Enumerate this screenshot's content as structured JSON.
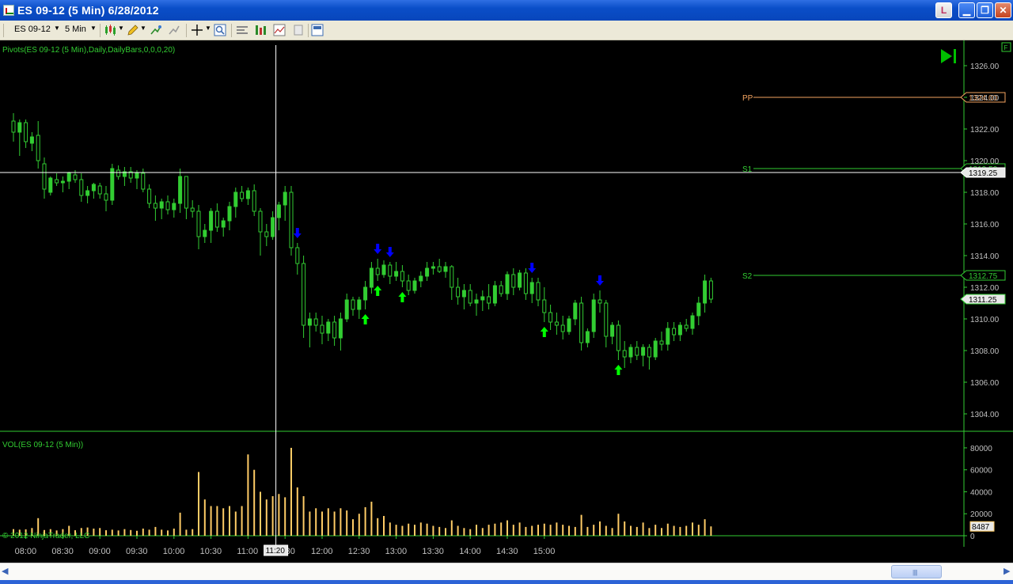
{
  "window": {
    "title": "ES 09-12 (5 Min)  6/28/2012",
    "link_label": "L"
  },
  "toolbar": {
    "instrument": "ES 09-12",
    "interval": "5 Min"
  },
  "icons": {
    "chart_style": "candlestick-icon",
    "draw": "pencil-icon",
    "crosshair": "crosshair-icon",
    "zoom": "zoom-icon",
    "properties": "properties-icon",
    "indicators": "indicators-icon",
    "strategies": "strategies-icon",
    "data_box": "data-box-icon",
    "templates": "templates-icon",
    "go_to_end": "play-end-icon"
  },
  "price_panel": {
    "indicator_label": "Pivots(ES 09-12 (5 Min),Daily,DailyBars,0,0,0,20)",
    "y_ticks": [
      "1326.00",
      "1324.00",
      "1322.00",
      "1320.00",
      "1318.00",
      "1316.00",
      "1314.00",
      "1312.00",
      "1310.00",
      "1308.00",
      "1306.00",
      "1304.00"
    ],
    "pivots": [
      {
        "name": "PP",
        "value": 1324.0,
        "label": "1324.00",
        "color": "#f4a460"
      },
      {
        "name": "S1",
        "value": 1319.5,
        "label": "1319.50",
        "color": "#32cd32"
      },
      {
        "name": "S2",
        "value": 1312.75,
        "label": "1312.75",
        "color": "#32cd32"
      }
    ],
    "crosshair_price": "1319.25",
    "last_price": "1311.25"
  },
  "volume_panel": {
    "indicator_label": "VOL(ES 09-12 (5 Min))",
    "y_ticks": [
      "80000",
      "60000",
      "40000",
      "20000",
      "0"
    ],
    "last_volume": "8487"
  },
  "time_axis": {
    "labels": [
      "08:00",
      "08:30",
      "09:00",
      "09:30",
      "10:00",
      "10:30",
      "11:00",
      "11:30",
      "12:00",
      "12:30",
      "13:00",
      "13:30",
      "14:00",
      "14:30",
      "15:00"
    ],
    "crosshair_time": "11:20"
  },
  "copyright": "© 2012 NinjaTrader, LLC",
  "corner_flag": "F",
  "colors": {
    "up_bar": "#32cd32",
    "volume_bar": "#ffcc66",
    "panel_divider": "#32cd32",
    "axis_text": "#c0c0c0",
    "buy_arrow": "#00ff00",
    "sell_arrow": "#0000ff"
  },
  "chart_data": {
    "type": "candlestick",
    "bars": [
      {
        "t": "07:50",
        "o": 1322.5,
        "h": 1323.0,
        "l": 1321.2,
        "c": 1321.8,
        "v": 6000
      },
      {
        "t": "07:55",
        "o": 1321.8,
        "h": 1322.6,
        "l": 1320.3,
        "c": 1322.4,
        "v": 5500
      },
      {
        "t": "08:00",
        "o": 1322.4,
        "h": 1322.6,
        "l": 1320.8,
        "c": 1321.2,
        "v": 5800
      },
      {
        "t": "08:05",
        "o": 1321.1,
        "h": 1321.8,
        "l": 1320.6,
        "c": 1321.5,
        "v": 7000
      },
      {
        "t": "08:10",
        "o": 1321.6,
        "h": 1322.5,
        "l": 1319.5,
        "c": 1320.0,
        "v": 16000
      },
      {
        "t": "08:15",
        "o": 1319.8,
        "h": 1320.2,
        "l": 1317.6,
        "c": 1318.2,
        "v": 5200
      },
      {
        "t": "08:20",
        "o": 1318.0,
        "h": 1319.0,
        "l": 1317.8,
        "c": 1318.9,
        "v": 6000
      },
      {
        "t": "08:25",
        "o": 1318.8,
        "h": 1319.2,
        "l": 1318.4,
        "c": 1318.6,
        "v": 4800
      },
      {
        "t": "08:30",
        "o": 1318.6,
        "h": 1319.0,
        "l": 1318.0,
        "c": 1318.7,
        "v": 6000
      },
      {
        "t": "08:35",
        "o": 1318.7,
        "h": 1319.3,
        "l": 1318.2,
        "c": 1319.2,
        "v": 9000
      },
      {
        "t": "08:40",
        "o": 1319.1,
        "h": 1319.4,
        "l": 1318.6,
        "c": 1318.8,
        "v": 5000
      },
      {
        "t": "08:45",
        "o": 1318.8,
        "h": 1319.2,
        "l": 1317.4,
        "c": 1317.8,
        "v": 7000
      },
      {
        "t": "08:50",
        "o": 1317.8,
        "h": 1318.4,
        "l": 1317.3,
        "c": 1318.1,
        "v": 7500
      },
      {
        "t": "08:55",
        "o": 1318.1,
        "h": 1318.6,
        "l": 1317.6,
        "c": 1318.5,
        "v": 6500
      },
      {
        "t": "09:00",
        "o": 1318.4,
        "h": 1318.6,
        "l": 1317.6,
        "c": 1317.9,
        "v": 7000
      },
      {
        "t": "09:05",
        "o": 1317.9,
        "h": 1318.4,
        "l": 1316.8,
        "c": 1317.5,
        "v": 5000
      },
      {
        "t": "09:10",
        "o": 1317.5,
        "h": 1319.8,
        "l": 1317.2,
        "c": 1319.5,
        "v": 5500
      },
      {
        "t": "09:15",
        "o": 1319.4,
        "h": 1319.7,
        "l": 1318.8,
        "c": 1319.0,
        "v": 4800
      },
      {
        "t": "09:20",
        "o": 1319.0,
        "h": 1319.6,
        "l": 1318.4,
        "c": 1319.3,
        "v": 6000
      },
      {
        "t": "09:25",
        "o": 1319.3,
        "h": 1319.6,
        "l": 1318.6,
        "c": 1318.9,
        "v": 5200
      },
      {
        "t": "09:30",
        "o": 1318.9,
        "h": 1319.4,
        "l": 1318.2,
        "c": 1319.2,
        "v": 4500
      },
      {
        "t": "09:35",
        "o": 1319.2,
        "h": 1319.5,
        "l": 1318.0,
        "c": 1318.2,
        "v": 6500
      },
      {
        "t": "09:40",
        "o": 1318.2,
        "h": 1318.5,
        "l": 1317.0,
        "c": 1317.3,
        "v": 5500
      },
      {
        "t": "09:45",
        "o": 1317.3,
        "h": 1317.8,
        "l": 1316.2,
        "c": 1317.0,
        "v": 8000
      },
      {
        "t": "09:50",
        "o": 1317.0,
        "h": 1317.6,
        "l": 1316.3,
        "c": 1317.4,
        "v": 5500
      },
      {
        "t": "09:55",
        "o": 1317.4,
        "h": 1317.8,
        "l": 1316.6,
        "c": 1316.9,
        "v": 4800
      },
      {
        "t": "10:00",
        "o": 1316.9,
        "h": 1317.6,
        "l": 1316.4,
        "c": 1317.3,
        "v": 6500
      },
      {
        "t": "10:05",
        "o": 1317.3,
        "h": 1319.5,
        "l": 1316.7,
        "c": 1319.0,
        "v": 21000
      },
      {
        "t": "10:10",
        "o": 1319.0,
        "h": 1317.2,
        "l": 1316.3,
        "c": 1317.0,
        "v": 5500
      },
      {
        "t": "10:15",
        "o": 1317.0,
        "h": 1317.5,
        "l": 1316.4,
        "c": 1316.8,
        "v": 6000
      },
      {
        "t": "10:20",
        "o": 1316.8,
        "h": 1317.2,
        "l": 1314.4,
        "c": 1315.2,
        "v": 58000
      },
      {
        "t": "10:25",
        "o": 1315.2,
        "h": 1316.0,
        "l": 1314.8,
        "c": 1315.6,
        "v": 33000
      },
      {
        "t": "10:30",
        "o": 1315.6,
        "h": 1317.0,
        "l": 1314.8,
        "c": 1316.8,
        "v": 27000
      },
      {
        "t": "10:35",
        "o": 1316.8,
        "h": 1317.3,
        "l": 1315.5,
        "c": 1315.8,
        "v": 27000
      },
      {
        "t": "10:40",
        "o": 1315.8,
        "h": 1316.4,
        "l": 1315.2,
        "c": 1316.2,
        "v": 25000
      },
      {
        "t": "10:45",
        "o": 1316.2,
        "h": 1317.4,
        "l": 1315.6,
        "c": 1317.1,
        "v": 27000
      },
      {
        "t": "10:50",
        "o": 1317.1,
        "h": 1318.3,
        "l": 1316.4,
        "c": 1318.0,
        "v": 22000
      },
      {
        "t": "10:55",
        "o": 1318.0,
        "h": 1318.4,
        "l": 1317.4,
        "c": 1317.6,
        "v": 27000
      },
      {
        "t": "11:00",
        "o": 1317.6,
        "h": 1318.3,
        "l": 1317.2,
        "c": 1318.1,
        "v": 74000
      },
      {
        "t": "11:05",
        "o": 1318.1,
        "h": 1318.5,
        "l": 1316.5,
        "c": 1316.8,
        "v": 60000
      },
      {
        "t": "11:10",
        "o": 1316.8,
        "h": 1317.0,
        "l": 1314.0,
        "c": 1315.5,
        "v": 40000
      },
      {
        "t": "11:15",
        "o": 1315.5,
        "h": 1316.0,
        "l": 1314.6,
        "c": 1315.2,
        "v": 33000
      },
      {
        "t": "11:20",
        "o": 1315.2,
        "h": 1316.8,
        "l": 1315.0,
        "c": 1316.4,
        "v": 36000
      },
      {
        "t": "11:25",
        "o": 1316.4,
        "h": 1317.4,
        "l": 1315.6,
        "c": 1317.2,
        "v": 38000
      },
      {
        "t": "11:30",
        "o": 1317.2,
        "h": 1318.4,
        "l": 1316.2,
        "c": 1318.0,
        "v": 35000
      },
      {
        "t": "11:35",
        "o": 1318.0,
        "h": 1318.4,
        "l": 1314.0,
        "c": 1314.5,
        "v": 80000
      },
      {
        "t": "11:40",
        "o": 1314.5,
        "h": 1314.8,
        "l": 1312.8,
        "c": 1313.5,
        "v": 44000
      },
      {
        "t": "11:45",
        "o": 1313.5,
        "h": 1314.0,
        "l": 1308.8,
        "c": 1309.6,
        "v": 36000
      },
      {
        "t": "11:50",
        "o": 1309.6,
        "h": 1310.4,
        "l": 1308.2,
        "c": 1310.0,
        "v": 22000
      },
      {
        "t": "11:55",
        "o": 1310.0,
        "h": 1310.4,
        "l": 1309.2,
        "c": 1309.6,
        "v": 25000
      },
      {
        "t": "12:00",
        "o": 1309.6,
        "h": 1310.2,
        "l": 1308.4,
        "c": 1309.1,
        "v": 22000
      },
      {
        "t": "12:05",
        "o": 1309.1,
        "h": 1310.0,
        "l": 1308.6,
        "c": 1309.8,
        "v": 25000
      },
      {
        "t": "12:10",
        "o": 1309.8,
        "h": 1310.2,
        "l": 1308.3,
        "c": 1308.8,
        "v": 22000
      },
      {
        "t": "12:15",
        "o": 1308.8,
        "h": 1310.4,
        "l": 1308.0,
        "c": 1310.0,
        "v": 25000
      },
      {
        "t": "12:20",
        "o": 1310.0,
        "h": 1311.6,
        "l": 1309.8,
        "c": 1311.2,
        "v": 23000
      },
      {
        "t": "12:25",
        "o": 1311.2,
        "h": 1311.4,
        "l": 1310.2,
        "c": 1310.6,
        "v": 15000
      },
      {
        "t": "12:30",
        "o": 1310.6,
        "h": 1311.4,
        "l": 1310.0,
        "c": 1311.2,
        "v": 20000
      },
      {
        "t": "12:35",
        "o": 1311.2,
        "h": 1312.4,
        "l": 1310.6,
        "c": 1312.0,
        "v": 26000
      },
      {
        "t": "12:40",
        "o": 1312.0,
        "h": 1313.6,
        "l": 1311.6,
        "c": 1313.2,
        "v": 31000
      },
      {
        "t": "12:45",
        "o": 1313.2,
        "h": 1313.8,
        "l": 1312.4,
        "c": 1312.8,
        "v": 16000
      },
      {
        "t": "12:50",
        "o": 1312.8,
        "h": 1313.7,
        "l": 1312.6,
        "c": 1313.4,
        "v": 18000
      },
      {
        "t": "12:55",
        "o": 1313.4,
        "h": 1313.6,
        "l": 1312.2,
        "c": 1312.7,
        "v": 12000
      },
      {
        "t": "13:00",
        "o": 1312.7,
        "h": 1313.6,
        "l": 1312.4,
        "c": 1313.0,
        "v": 10000
      },
      {
        "t": "13:05",
        "o": 1313.0,
        "h": 1313.4,
        "l": 1312.0,
        "c": 1312.4,
        "v": 9000
      },
      {
        "t": "13:10",
        "o": 1312.4,
        "h": 1312.8,
        "l": 1311.5,
        "c": 1311.8,
        "v": 11000
      },
      {
        "t": "13:15",
        "o": 1311.8,
        "h": 1312.6,
        "l": 1311.6,
        "c": 1312.4,
        "v": 10000
      },
      {
        "t": "13:20",
        "o": 1312.4,
        "h": 1313.0,
        "l": 1312.0,
        "c": 1312.7,
        "v": 12000
      },
      {
        "t": "13:25",
        "o": 1312.7,
        "h": 1313.6,
        "l": 1312.4,
        "c": 1313.2,
        "v": 11000
      },
      {
        "t": "13:30",
        "o": 1313.2,
        "h": 1313.6,
        "l": 1312.8,
        "c": 1313.3,
        "v": 9000
      },
      {
        "t": "13:35",
        "o": 1313.3,
        "h": 1313.8,
        "l": 1312.9,
        "c": 1313.0,
        "v": 8000
      },
      {
        "t": "13:40",
        "o": 1313.0,
        "h": 1313.6,
        "l": 1312.6,
        "c": 1313.3,
        "v": 7000
      },
      {
        "t": "13:45",
        "o": 1313.3,
        "h": 1313.4,
        "l": 1311.2,
        "c": 1312.0,
        "v": 14000
      },
      {
        "t": "13:50",
        "o": 1312.0,
        "h": 1312.6,
        "l": 1310.9,
        "c": 1311.4,
        "v": 9000
      },
      {
        "t": "13:55",
        "o": 1311.4,
        "h": 1312.2,
        "l": 1310.6,
        "c": 1311.8,
        "v": 7000
      },
      {
        "t": "14:00",
        "o": 1311.8,
        "h": 1312.2,
        "l": 1310.8,
        "c": 1311.0,
        "v": 6000
      },
      {
        "t": "14:05",
        "o": 1311.0,
        "h": 1311.6,
        "l": 1310.2,
        "c": 1311.2,
        "v": 10000
      },
      {
        "t": "14:10",
        "o": 1311.2,
        "h": 1311.8,
        "l": 1310.5,
        "c": 1311.4,
        "v": 7000
      },
      {
        "t": "14:15",
        "o": 1311.4,
        "h": 1312.2,
        "l": 1310.6,
        "c": 1311.0,
        "v": 10000
      },
      {
        "t": "14:20",
        "o": 1311.0,
        "h": 1312.4,
        "l": 1310.8,
        "c": 1312.1,
        "v": 11000
      },
      {
        "t": "14:25",
        "o": 1312.1,
        "h": 1312.4,
        "l": 1311.4,
        "c": 1311.6,
        "v": 12000
      },
      {
        "t": "14:30",
        "o": 1311.6,
        "h": 1313.0,
        "l": 1311.2,
        "c": 1312.8,
        "v": 14000
      },
      {
        "t": "14:35",
        "o": 1312.8,
        "h": 1313.2,
        "l": 1311.5,
        "c": 1312.0,
        "v": 10000
      },
      {
        "t": "14:40",
        "o": 1312.0,
        "h": 1313.1,
        "l": 1311.8,
        "c": 1312.9,
        "v": 12000
      },
      {
        "t": "14:45",
        "o": 1312.9,
        "h": 1313.2,
        "l": 1311.2,
        "c": 1311.6,
        "v": 8000
      },
      {
        "t": "14:50",
        "o": 1311.6,
        "h": 1312.6,
        "l": 1311.0,
        "c": 1312.3,
        "v": 9000
      },
      {
        "t": "14:55",
        "o": 1312.3,
        "h": 1312.6,
        "l": 1310.8,
        "c": 1311.2,
        "v": 10000
      },
      {
        "t": "15:00",
        "o": 1311.2,
        "h": 1312.0,
        "l": 1309.8,
        "c": 1310.4,
        "v": 11000
      },
      {
        "t": "15:05",
        "o": 1310.4,
        "h": 1310.9,
        "l": 1309.3,
        "c": 1309.8,
        "v": 10000
      },
      {
        "t": "15:10",
        "o": 1309.8,
        "h": 1310.4,
        "l": 1309.0,
        "c": 1309.6,
        "v": 12000
      },
      {
        "t": "15:15",
        "o": 1309.6,
        "h": 1310.2,
        "l": 1308.7,
        "c": 1309.2,
        "v": 10000
      },
      {
        "t": "15:20",
        "o": 1309.2,
        "h": 1310.2,
        "l": 1309.0,
        "c": 1310.0,
        "v": 9000
      },
      {
        "t": "15:25",
        "o": 1310.0,
        "h": 1311.2,
        "l": 1309.6,
        "c": 1311.0,
        "v": 8000
      },
      {
        "t": "15:30",
        "o": 1311.0,
        "h": 1311.4,
        "l": 1308.0,
        "c": 1308.5,
        "v": 19000
      },
      {
        "t": "15:35",
        "o": 1308.5,
        "h": 1309.4,
        "l": 1308.2,
        "c": 1309.2,
        "v": 8000
      },
      {
        "t": "15:40",
        "o": 1309.2,
        "h": 1311.6,
        "l": 1308.8,
        "c": 1311.2,
        "v": 10000
      },
      {
        "t": "15:45",
        "o": 1311.2,
        "h": 1311.8,
        "l": 1310.4,
        "c": 1311.0,
        "v": 13000
      },
      {
        "t": "15:50",
        "o": 1311.0,
        "h": 1311.2,
        "l": 1308.2,
        "c": 1308.9,
        "v": 9000
      },
      {
        "t": "15:55",
        "o": 1308.9,
        "h": 1309.8,
        "l": 1308.4,
        "c": 1309.6,
        "v": 7000
      },
      {
        "t": "16:00",
        "o": 1309.6,
        "h": 1309.9,
        "l": 1307.4,
        "c": 1308.0,
        "v": 20000
      },
      {
        "t": "16:05",
        "o": 1308.0,
        "h": 1308.6,
        "l": 1306.9,
        "c": 1307.6,
        "v": 13000
      },
      {
        "t": "16:10",
        "o": 1307.6,
        "h": 1308.4,
        "l": 1307.2,
        "c": 1308.2,
        "v": 9000
      },
      {
        "t": "16:15",
        "o": 1308.2,
        "h": 1308.6,
        "l": 1307.4,
        "c": 1307.7,
        "v": 8000
      },
      {
        "t": "16:20",
        "o": 1307.7,
        "h": 1308.4,
        "l": 1307.0,
        "c": 1308.2,
        "v": 12000
      },
      {
        "t": "16:25",
        "o": 1308.2,
        "h": 1308.4,
        "l": 1306.8,
        "c": 1307.6,
        "v": 7000
      },
      {
        "t": "16:30",
        "o": 1307.6,
        "h": 1308.8,
        "l": 1307.4,
        "c": 1308.6,
        "v": 10000
      },
      {
        "t": "16:35",
        "o": 1308.6,
        "h": 1309.2,
        "l": 1308.0,
        "c": 1308.4,
        "v": 7000
      },
      {
        "t": "16:40",
        "o": 1308.4,
        "h": 1309.8,
        "l": 1308.0,
        "c": 1309.4,
        "v": 11000
      },
      {
        "t": "16:45",
        "o": 1309.4,
        "h": 1309.8,
        "l": 1308.6,
        "c": 1309.0,
        "v": 9000
      },
      {
        "t": "16:50",
        "o": 1309.0,
        "h": 1309.8,
        "l": 1308.6,
        "c": 1309.6,
        "v": 8000
      },
      {
        "t": "16:55",
        "o": 1309.6,
        "h": 1310.0,
        "l": 1309.2,
        "c": 1309.4,
        "v": 9000
      },
      {
        "t": "17:00",
        "o": 1309.4,
        "h": 1310.4,
        "l": 1309.0,
        "c": 1310.2,
        "v": 12000
      },
      {
        "t": "17:05",
        "o": 1310.2,
        "h": 1311.4,
        "l": 1309.6,
        "c": 1311.0,
        "v": 10000
      },
      {
        "t": "17:10",
        "o": 1311.0,
        "h": 1312.8,
        "l": 1310.4,
        "c": 1312.4,
        "v": 15000
      },
      {
        "t": "17:15",
        "o": 1312.4,
        "h": 1312.6,
        "l": 1311.0,
        "c": 1311.25,
        "v": 8487
      }
    ],
    "signals": [
      {
        "bar": 46,
        "type": "sell"
      },
      {
        "bar": 57,
        "type": "buy"
      },
      {
        "bar": 59,
        "type": "buy"
      },
      {
        "bar": 59,
        "type": "sell"
      },
      {
        "bar": 61,
        "type": "sell"
      },
      {
        "bar": 63,
        "type": "buy"
      },
      {
        "bar": 84,
        "type": "sell"
      },
      {
        "bar": 86,
        "type": "buy"
      },
      {
        "bar": 95,
        "type": "sell"
      },
      {
        "bar": 98,
        "type": "buy"
      }
    ],
    "price_range": [
      1303.0,
      1327.0
    ],
    "volume_range": [
      0,
      85000
    ],
    "crosshair": {
      "time": "11:20",
      "price": 1319.25
    }
  }
}
